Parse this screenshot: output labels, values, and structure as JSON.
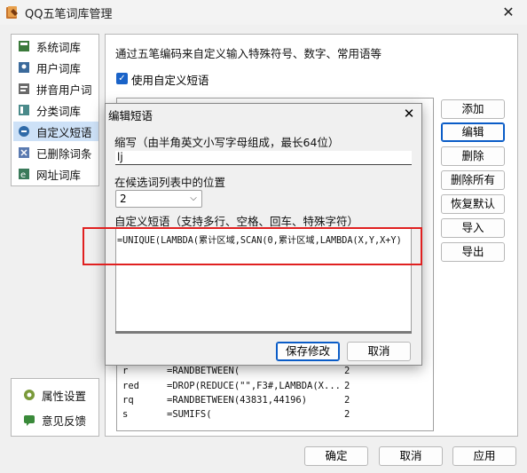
{
  "window": {
    "title": "QQ五笔词库管理",
    "close": "✕"
  },
  "sidebar": {
    "items": [
      {
        "label": "系统词库",
        "icon": "book-icon"
      },
      {
        "label": "用户词库",
        "icon": "user-book-icon"
      },
      {
        "label": "拼音用户词",
        "icon": "pinyin-book-icon"
      },
      {
        "label": "分类词库",
        "icon": "category-book-icon"
      },
      {
        "label": "自定义短语",
        "icon": "custom-phrase-icon"
      },
      {
        "label": "已删除词条",
        "icon": "deleted-book-icon"
      },
      {
        "label": "网址词库",
        "icon": "url-book-icon"
      }
    ],
    "active_index": 4,
    "bottom": [
      {
        "label": "属性设置",
        "icon": "gear-icon"
      },
      {
        "label": "意见反馈",
        "icon": "feedback-icon"
      }
    ]
  },
  "main": {
    "description": "通过五笔编码来自定义输入特殊符号、数字、常用语等",
    "use_custom_label": "使用自定义短语",
    "use_custom_checked": "✓",
    "rows": [
      {
        "abbr": "r",
        "phrase": "=RANDBETWEEN(",
        "pos": "2"
      },
      {
        "abbr": "red",
        "phrase": "=DROP(REDUCE(\"\",F3#,LAMBDA(X...",
        "pos": "2"
      },
      {
        "abbr": "rq",
        "phrase": "=RANDBETWEEN(43831,44196)",
        "pos": "2"
      },
      {
        "abbr": "s",
        "phrase": "=SUMIFS(",
        "pos": "2"
      }
    ],
    "buttons": [
      "添加",
      "编辑",
      "删除",
      "删除所有",
      "恢复默认",
      "导入",
      "导出"
    ]
  },
  "footer": {
    "ok": "确定",
    "cancel": "取消",
    "apply": "应用"
  },
  "dialog": {
    "title": "编辑短语",
    "close": "✕",
    "abbr_label": "缩写（由半角英文小写字母组成，最长64位）",
    "abbr_value": "lj",
    "pos_label": "在候选词列表中的位置",
    "pos_value": "2",
    "phrase_label": "自定义短语（支持多行、空格、回车、特殊字符）",
    "phrase_value": "=UNIQUE(LAMBDA(累计区域,SCAN(0,累计区域,LAMBDA(X,Y,X+Y)",
    "save": "保存修改",
    "cancel": "取消"
  },
  "colors": {
    "accent": "#1a63c8",
    "highlight": "#e02020",
    "active_item": "#cde1f7"
  }
}
